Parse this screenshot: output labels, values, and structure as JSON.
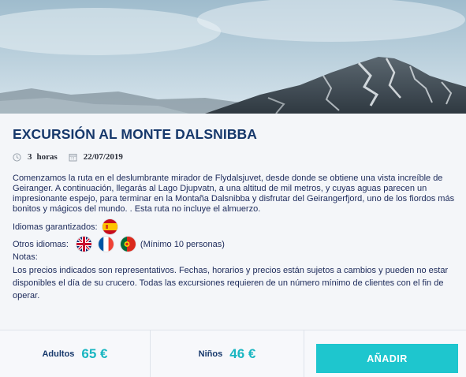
{
  "header": {
    "image_alt": "Monte Dalsnibba"
  },
  "excursion": {
    "title": "EXCURSIÓN AL MONTE DALSNIBBA",
    "duration_value": "3",
    "duration_unit": "horas",
    "date": "22/07/2019",
    "description": "Comenzamos la ruta en el deslumbrante mirador de Flydalsjuvet, desde donde se obtiene una vista increíble de Geiranger. A continuación, llegarás al Lago Djupvatn, a una altitud de mil metros, y cuyas aguas parecen un impresionante espejo, para terminar en la Montaña Dalsnibba y disfrutar del Geirangerfjord, uno de los fiordos más bonitos y mágicos del mundo. . Esta ruta no incluye el almuerzo.",
    "languages_guaranteed_label": "Idiomas garantizados:",
    "languages_guaranteed": [
      "spain-flag-icon"
    ],
    "other_languages_label": "Otros idiomas:",
    "other_languages": [
      "uk-flag-icon",
      "france-flag-icon",
      "portugal-flag-icon"
    ],
    "other_languages_note": "(Mínimo 10 personas)",
    "notes_label": "Notas:",
    "notes": "Los precios indicados son representativos. Fechas, horarios y precios están sujetos a cambios y pueden no estar disponibles el día de su crucero. Todas las excursiones requieren de un número mínimo de clientes con el fin de operar."
  },
  "pricing": {
    "adults_label": "Adultos",
    "adults_price": "65 €",
    "children_label": "Niños",
    "children_price": "46 €",
    "add_button": "AÑADIR"
  },
  "colors": {
    "title": "#16386b",
    "accent": "#1ec6ce",
    "price": "#19b6c1",
    "text": "#1c2a5a"
  }
}
